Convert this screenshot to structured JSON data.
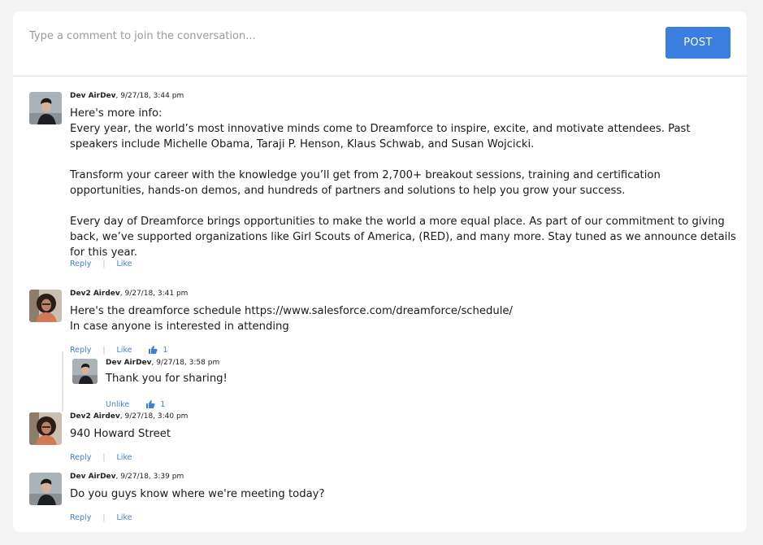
{
  "composer": {
    "placeholder": "Type a comment to join the conversation...",
    "post_label": "POST"
  },
  "comments": [
    {
      "author": "Dev AirDev",
      "time": ", 9/27/18, 3:44 pm",
      "lines": [
        "Here's more info:",
        "Every year, the world’s most innovative minds come to Dreamforce to inspire, excite, and motivate attendees. Past speakers include Michelle Obama, Taraji P. Henson, Klaus Schwab, and Susan Wojcicki.",
        "Transform your career with the knowledge you’ll get from 2,700+ breakout sessions, training and certification opportunities, hands-on demos, and hundreds of partners and solutions to help you grow your success.",
        "Every day of Dreamforce brings opportunities to make the world a more equal place. As part of our commitment to giving back, we’ve supported organizations like Girl Scouts of America, (RED), and many more. Stay tuned as we announce details for this year."
      ],
      "reply_label": "Reply",
      "like_label": "Like"
    },
    {
      "author": "Dev2 Airdev",
      "time": ", 9/27/18, 3:41 pm",
      "lines": [
        "Here's the dreamforce schedule https://www.salesforce.com/dreamforce/schedule/",
        "In case anyone is interested in attending"
      ],
      "reply_label": "Reply",
      "like_label": "Like",
      "like_count": "1",
      "reply": {
        "author": "Dev AirDev",
        "time": ", 9/27/18, 3:58 pm",
        "text": "Thank you for sharing!",
        "unlike_label": "Unlike",
        "like_count": "1"
      }
    },
    {
      "author": "Dev2 Airdev",
      "time": ", 9/27/18, 3:40 pm",
      "lines": [
        "940 Howard Street"
      ],
      "reply_label": "Reply",
      "like_label": "Like"
    },
    {
      "author": "Dev AirDev",
      "time": ", 9/27/18, 3:39 pm",
      "lines": [
        "Do you guys know where we're meeting today?"
      ],
      "reply_label": "Reply",
      "like_label": "Like"
    }
  ]
}
